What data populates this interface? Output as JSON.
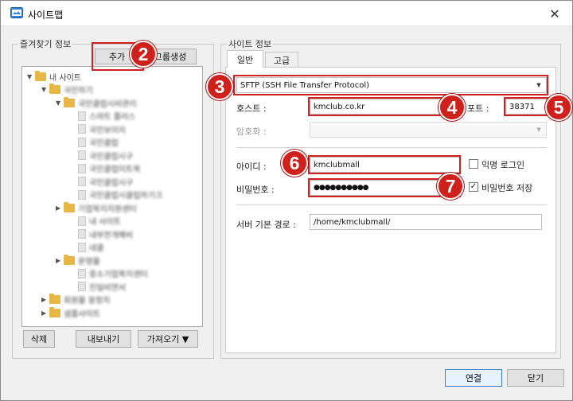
{
  "window": {
    "title": "사이트맵",
    "close": "✕"
  },
  "left": {
    "group_label": "즐겨찾기 정보",
    "add_button": "추가",
    "group_button": "그룹생성",
    "tree": [
      {
        "label": "내 사이트",
        "type": "folder",
        "level": 0,
        "expanded": true
      },
      {
        "label": "국민하기",
        "type": "folder",
        "level": 1,
        "expanded": true
      },
      {
        "label": "국민클럽시비관리",
        "type": "folder",
        "level": 2,
        "expanded": true
      },
      {
        "label": "스마트 플러스",
        "type": "doc",
        "level": 3
      },
      {
        "label": "국민보이지",
        "type": "doc",
        "level": 3
      },
      {
        "label": "국민클럽",
        "type": "doc",
        "level": 3
      },
      {
        "label": "국민클럽시구",
        "type": "doc",
        "level": 3
      },
      {
        "label": "국민클럽이트북",
        "type": "doc",
        "level": 3
      },
      {
        "label": "국민클럽시구",
        "type": "doc",
        "level": 3
      },
      {
        "label": "국민클럽시클럽하기크",
        "type": "doc",
        "level": 3
      },
      {
        "label": "기업북지지원센터",
        "type": "folder",
        "level": 2,
        "expanded": false
      },
      {
        "label": "내 사이트",
        "type": "doc",
        "level": 3
      },
      {
        "label": "내부전개해비",
        "type": "doc",
        "level": 3
      },
      {
        "label": "네클",
        "type": "doc",
        "level": 3
      },
      {
        "label": "운영몰",
        "type": "folder",
        "level": 2,
        "expanded": false
      },
      {
        "label": "중소기업복지센터",
        "type": "doc",
        "level": 3
      },
      {
        "label": "진일비연서",
        "type": "doc",
        "level": 3
      },
      {
        "label": "회원몰 몽정치",
        "type": "folder",
        "level": 1,
        "expanded": false
      },
      {
        "label": "샘플사이트",
        "type": "folder",
        "level": 1,
        "expanded": false
      }
    ],
    "delete_button": "삭제",
    "export_button": "내보내기",
    "import_button": "가져오기 ▼"
  },
  "right": {
    "group_label": "사이트 정보",
    "tabs": [
      {
        "label": "일반"
      },
      {
        "label": "고급"
      }
    ],
    "protocol": "SFTP (SSH File Transfer Protocol)",
    "host_label": "호스트 :",
    "host_value": "kmclub.co.kr",
    "port_label": "포트 :",
    "port_value": "38371",
    "encoding_label": "암호화 :",
    "encoding_value": "",
    "id_label": "아이디 :",
    "id_value": "kmclubmall",
    "anonymous_label": "익명 로그인",
    "anonymous_checked": false,
    "password_label": "비밀번호 :",
    "password_value": "●●●●●●●●●●",
    "save_password_label": "비밀번호 저장",
    "save_password_checked": true,
    "check_mark": "✓",
    "path_label": "서버 기본 경로 :",
    "path_value": "/home/kmclubmall/"
  },
  "footer": {
    "connect_button": "연결",
    "close_button": "닫기"
  },
  "annotations": {
    "b2": "2",
    "b3": "3",
    "b4": "4",
    "b5": "5",
    "b6": "6",
    "b7": "7"
  },
  "colors": {
    "annotation_red": "#d0201b",
    "folder": "#e8b645",
    "connect_border": "#3c7fd0"
  }
}
